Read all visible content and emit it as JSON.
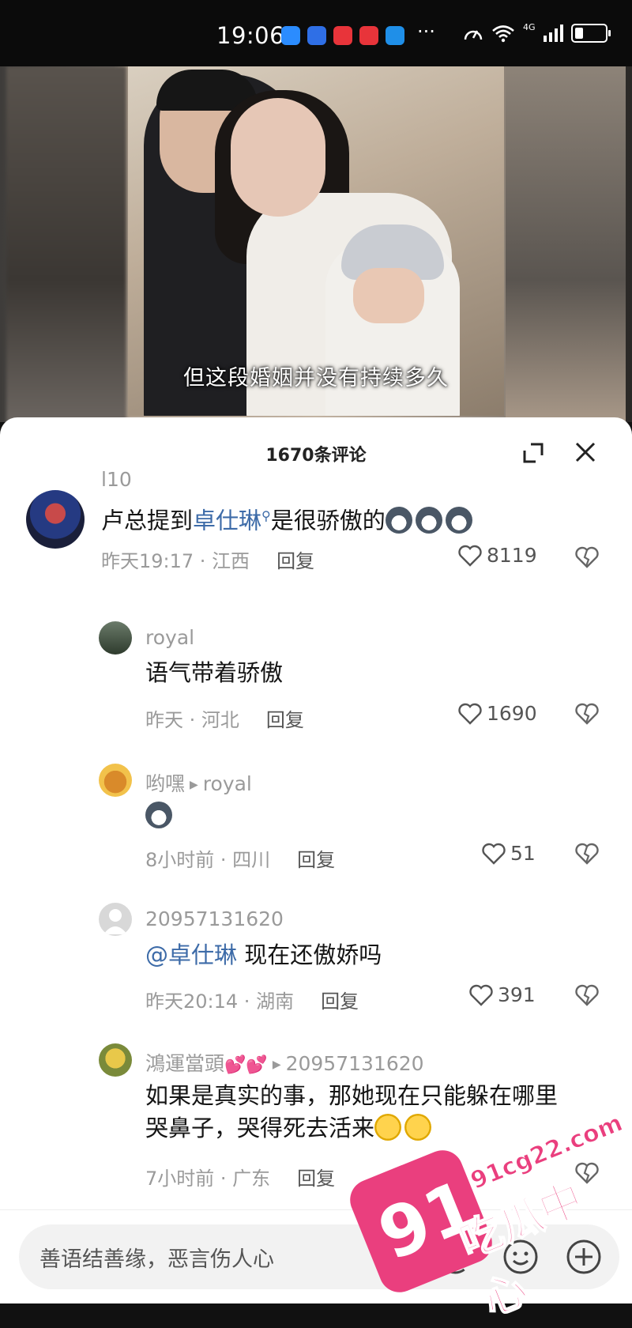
{
  "status_bar": {
    "time": "19:06",
    "more": "···",
    "network": "4G"
  },
  "video": {
    "subtitle": "但这段婚姻并没有持续多久"
  },
  "comments_panel": {
    "title": "1670条评论",
    "comments": [
      {
        "username": "l10",
        "text_before": "卢总提到",
        "mention": "卓仕琳",
        "text_after": "是很骄傲的",
        "time": "昨天19:17",
        "location": "江西",
        "reply_label": "回复",
        "likes": "8119"
      },
      {
        "username": "royal",
        "text": "语气带着骄傲",
        "time": "昨天",
        "location": "河北",
        "reply_label": "回复",
        "likes": "1690"
      },
      {
        "username": "哟嘿",
        "reply_to": "royal",
        "text": "",
        "time": "8小时前",
        "location": "四川",
        "reply_label": "回复",
        "likes": "51"
      },
      {
        "username": "20957131620",
        "mention": "@卓仕琳",
        "text": " 现在还傲娇吗",
        "time": "昨天20:14",
        "location": "湖南",
        "reply_label": "回复",
        "likes": "391"
      },
      {
        "username": "鴻運當頭",
        "reply_to": "20957131620",
        "text_line1": "如果是真实的事，那她现在只能躲在哪里",
        "text_line2": "哭鼻子，哭得死去活来",
        "time": "7小时前",
        "location": "广东",
        "reply_label": "回复"
      }
    ]
  },
  "input_bar": {
    "placeholder": "善语结善缘，恶言伤人心",
    "at_symbol": "@"
  },
  "watermark": {
    "number": "91",
    "url": "91cg22.com",
    "text": "吃瓜中心"
  },
  "colors": {
    "mention": "#3d6ba8",
    "watermark": "#ea3f7e",
    "meta": "#9a9a9a"
  }
}
